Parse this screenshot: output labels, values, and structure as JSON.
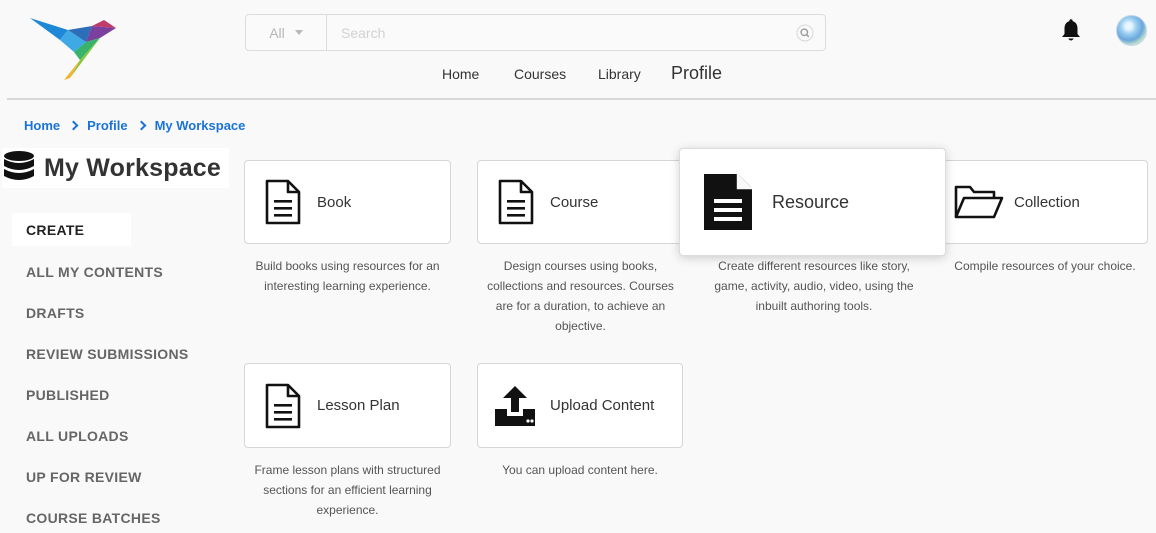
{
  "header": {
    "search": {
      "filter_label": "All",
      "placeholder": "Search",
      "value": ""
    },
    "nav": [
      {
        "label": "Home"
      },
      {
        "label": "Courses"
      },
      {
        "label": "Library"
      },
      {
        "label": "Profile"
      }
    ],
    "notification_icon": "bell-icon",
    "logo_icon": "hummingbird-logo"
  },
  "breadcrumb": [
    "Home",
    "Profile",
    "My Workspace"
  ],
  "sidebar": {
    "title": "My Workspace",
    "title_icon": "database-icon",
    "items": [
      {
        "label": "CREATE",
        "active": true
      },
      {
        "label": "ALL MY CONTENTS"
      },
      {
        "label": "DRAFTS"
      },
      {
        "label": "REVIEW SUBMISSIONS"
      },
      {
        "label": "PUBLISHED"
      },
      {
        "label": "ALL UPLOADS"
      },
      {
        "label": "UP FOR REVIEW"
      },
      {
        "label": "COURSE BATCHES"
      }
    ]
  },
  "cards": [
    {
      "label": "Book",
      "icon": "document-icon",
      "desc_lines": [
        "Build books using resources for an",
        "interesting learning experience."
      ]
    },
    {
      "label": "Course",
      "icon": "document-icon",
      "desc_lines": [
        "Design courses using books,",
        "collections and resources. Courses",
        "are for a duration, to achieve an",
        "objective."
      ]
    },
    {
      "label": "Resource",
      "icon": "document-filled-icon",
      "desc_lines": [
        "Create different resources like story,",
        "game, activity, audio, video, using the",
        "inbuilt authoring tools."
      ]
    },
    {
      "label": "Collection",
      "icon": "folder-open-icon",
      "desc_lines": [
        "Compile resources of your choice."
      ]
    },
    {
      "label": "Lesson Plan",
      "icon": "document-icon",
      "desc_lines": [
        "Frame lesson plans with structured",
        "sections for an efficient learning",
        "experience."
      ]
    },
    {
      "label": "Upload Content",
      "icon": "upload-icon",
      "desc_lines": [
        "You can upload content here."
      ]
    }
  ],
  "colors": {
    "link": "#1a73d9",
    "background": "#f9f9f9",
    "card_border": "#d6d6d6"
  }
}
